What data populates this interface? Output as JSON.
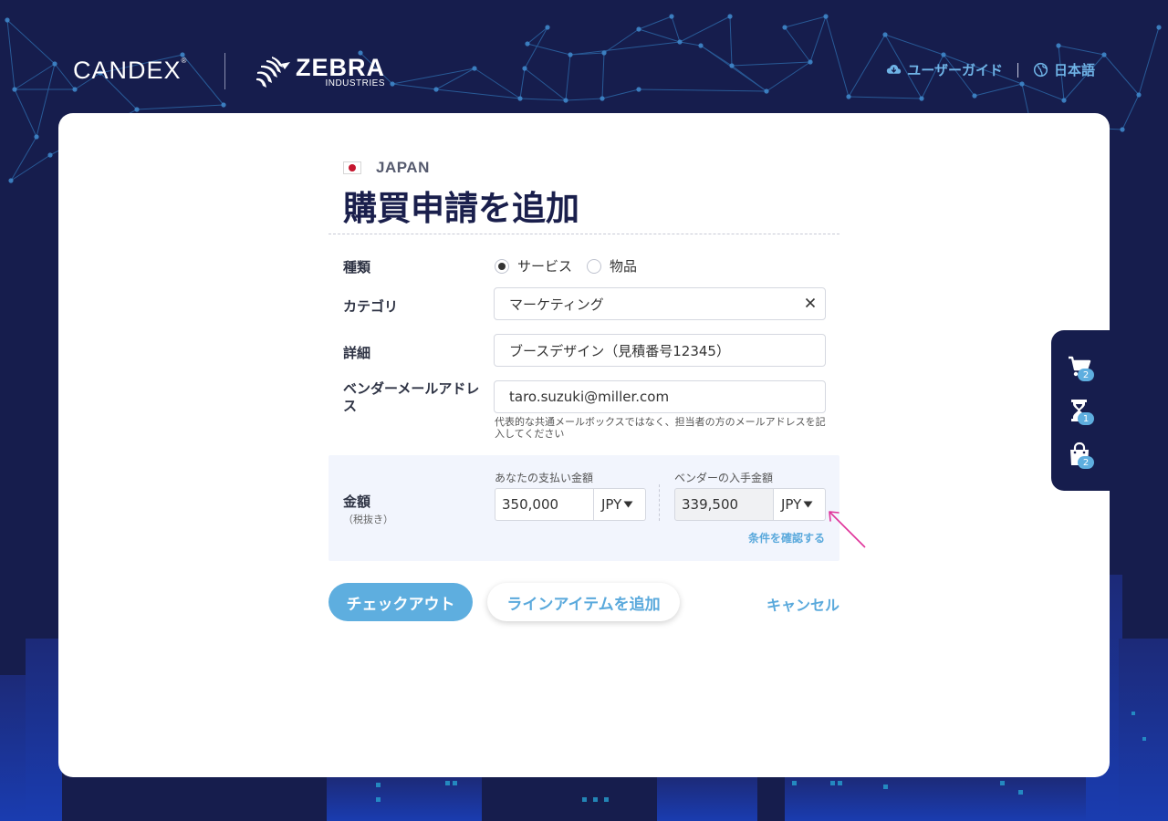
{
  "header": {
    "brand_candex": "CANDEX",
    "brand_zebra": "ZEBRA",
    "brand_zebra_sub": "INDUSTRIES",
    "user_guide": "ユーザーガイド",
    "language": "日本語"
  },
  "form": {
    "country": "JAPAN",
    "title": "購買申請を追加",
    "type": {
      "label": "種類",
      "options": [
        "サービス",
        "物品"
      ],
      "selected": "サービス"
    },
    "category": {
      "label": "カテゴリ",
      "value": "マーケティング"
    },
    "details": {
      "label": "詳細",
      "value": "ブースデザイン（見積番号12345）"
    },
    "vendor_email": {
      "label": "ベンダーメールアドレス",
      "value": "taro.suzuki@miller.com",
      "help": "代表的な共通メールボックスではなく、担当者の方のメールアドレスを記入してください"
    },
    "amount": {
      "label": "金額",
      "sublabel": "（税抜き）",
      "payer_label": "あなたの支払い金額",
      "payer_value": "350,000",
      "payer_currency": "JPY",
      "vendor_label": "ベンダーの入手金額",
      "vendor_value": "339,500",
      "vendor_currency": "JPY",
      "terms_link": "条件を確認する"
    },
    "buttons": {
      "checkout": "チェックアウト",
      "add_line_item": "ラインアイテムを追加",
      "cancel": "キャンセル"
    }
  },
  "side_panel": {
    "cart_count": "2",
    "pending_count": "1",
    "orders_count": "2"
  },
  "colors": {
    "background": "#161d4d",
    "accent": "#5eaedf",
    "title": "#1a1f4c",
    "annotation_arrow": "#e0339a"
  }
}
